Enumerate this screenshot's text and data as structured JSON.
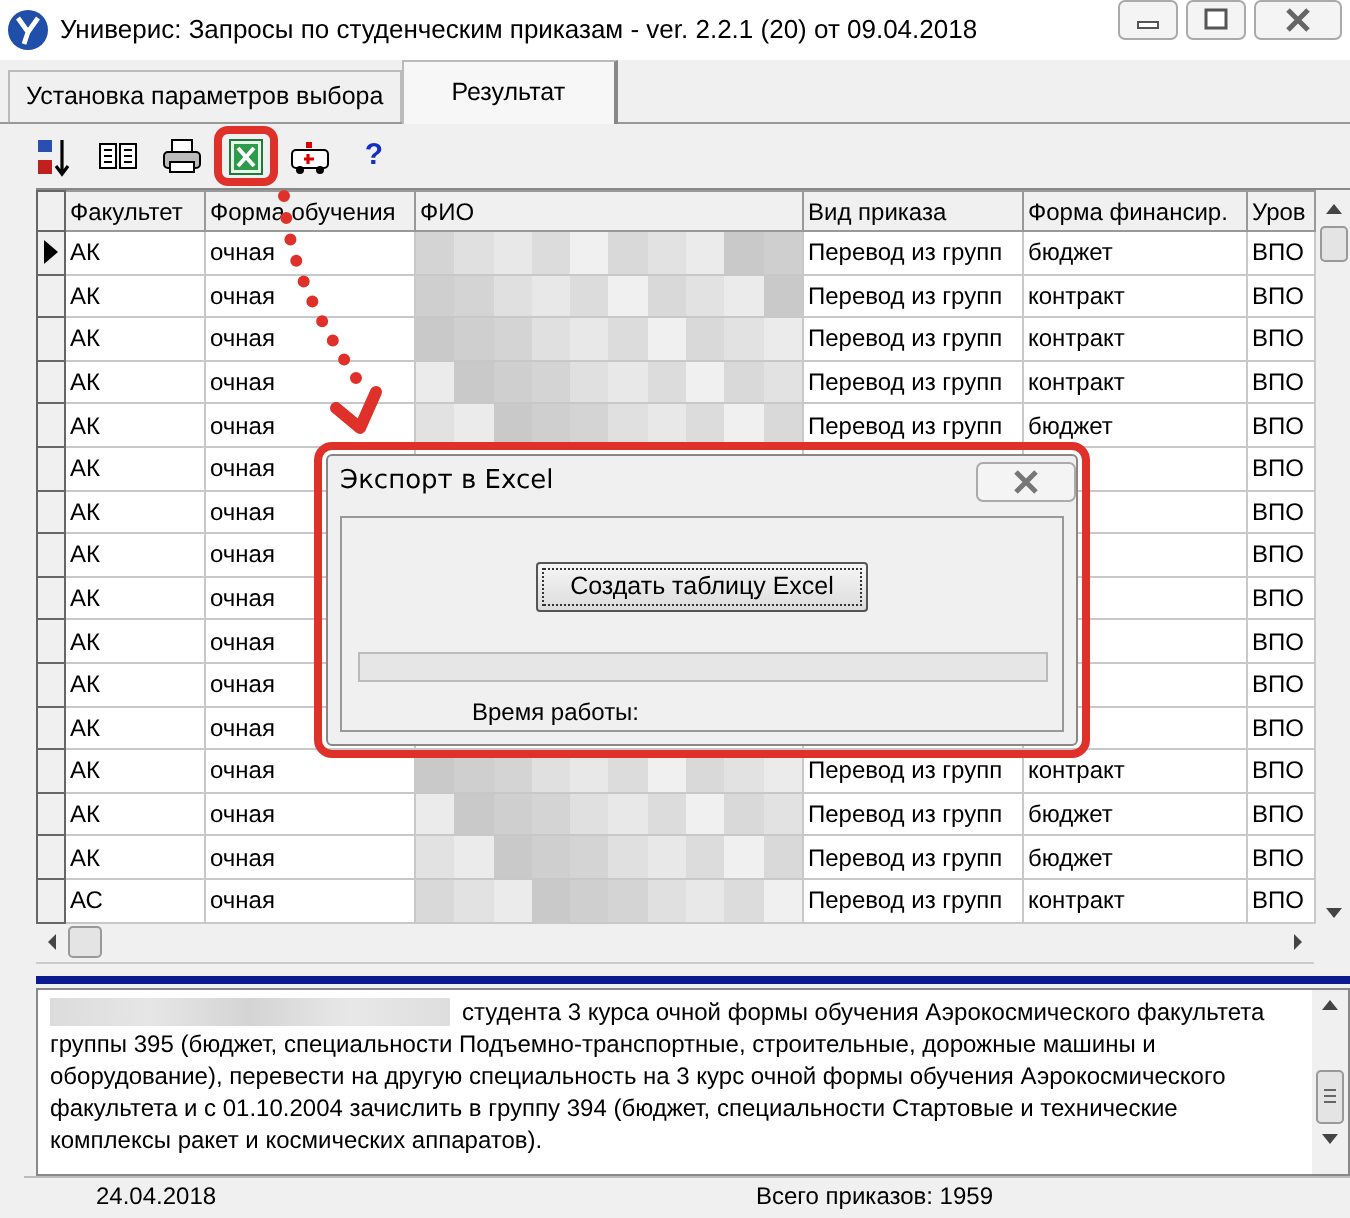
{
  "window": {
    "title": "Универис: Запросы по студенческим приказам  -  ver. 2.2.1 (20) от 09.04.2018"
  },
  "tabs": [
    {
      "label": "Установка параметров выбора",
      "selected": false
    },
    {
      "label": "Результат",
      "selected": true
    }
  ],
  "toolbar": [
    {
      "kind": "sort",
      "annotated": false
    },
    {
      "kind": "columns",
      "annotated": false
    },
    {
      "kind": "print",
      "annotated": false
    },
    {
      "kind": "excel",
      "annotated": true
    },
    {
      "kind": "ambulance",
      "annotated": false
    },
    {
      "kind": "help",
      "label": "?",
      "annotated": false
    }
  ],
  "table": {
    "columns": [
      "Факультет",
      "Форма обучения",
      "ФИО",
      "Вид приказа",
      "Форма финансир.",
      "Уров"
    ],
    "rows": [
      {
        "selected": true,
        "faculty": "АК",
        "form": "очная",
        "order_type": "Перевод из групп",
        "financing": "бюджет",
        "level_col": "ВПО"
      },
      {
        "selected": false,
        "faculty": "АК",
        "form": "очная",
        "order_type": "Перевод из групп",
        "financing": "контракт",
        "level_col": "ВПО"
      },
      {
        "selected": false,
        "faculty": "АК",
        "form": "очная",
        "order_type": "Перевод из групп",
        "financing": "контракт",
        "level_col": "ВПО"
      },
      {
        "selected": false,
        "faculty": "АК",
        "form": "очная",
        "order_type": "Перевод из групп",
        "financing": "контракт",
        "level_col": "ВПО"
      },
      {
        "selected": false,
        "faculty": "АК",
        "form": "очная",
        "order_type": "Перевод из групп",
        "financing": "бюджет",
        "level_col": "ВПО"
      },
      {
        "selected": false,
        "faculty": "АК",
        "form": "очная",
        "level_col": "ВПО"
      },
      {
        "selected": false,
        "faculty": "АК",
        "form": "очная",
        "level_col": "ВПО"
      },
      {
        "selected": false,
        "faculty": "АК",
        "form": "очная",
        "level_col": "ВПО"
      },
      {
        "selected": false,
        "faculty": "АК",
        "form": "очная",
        "level_col": "ВПО"
      },
      {
        "selected": false,
        "faculty": "АК",
        "form": "очная",
        "level_col": "ВПО"
      },
      {
        "selected": false,
        "faculty": "АК",
        "form": "очная",
        "level_col": "ВПО"
      },
      {
        "selected": false,
        "faculty": "АК",
        "form": "очная",
        "level_col": "ВПО"
      },
      {
        "selected": false,
        "faculty": "АК",
        "form": "очная",
        "order_type": "Перевод из групп",
        "financing": "контракт",
        "level_col": "ВПО"
      },
      {
        "selected": false,
        "faculty": "АК",
        "form": "очная",
        "order_type": "Перевод из групп",
        "financing": "бюджет",
        "level_col": "ВПО"
      },
      {
        "selected": false,
        "faculty": "АК",
        "form": "очная",
        "order_type": "Перевод из групп",
        "financing": "бюджет",
        "level_col": "ВПО"
      },
      {
        "selected": false,
        "faculty": "АС",
        "form": "очная",
        "order_type": "Перевод из групп",
        "financing": "контракт",
        "level_col": "ВПО"
      }
    ]
  },
  "dialog": {
    "title": "Экспорт в Excel",
    "button": "Создать таблицу Excel",
    "progress": {
      "level": 0
    },
    "elapsed_label": "Время работы:"
  },
  "memo": {
    "text": "студента 3 курса очной формы обучения Аэрокосмического факультета группы 395 (бюджет, специальности Подъемно-транспортные, строительные, дорожные машины и оборудование), перевести на другую специальность на 3 курс очной формы обучения Аэрокосмического факультета и с 01.10.2004 зачислить в группу 394 (бюджет, специальности Стартовые и технические комплексы ракет и космических аппаратов)."
  },
  "status_bar": {
    "date": "24.04.2018",
    "total": "Всего приказов: 1959"
  }
}
